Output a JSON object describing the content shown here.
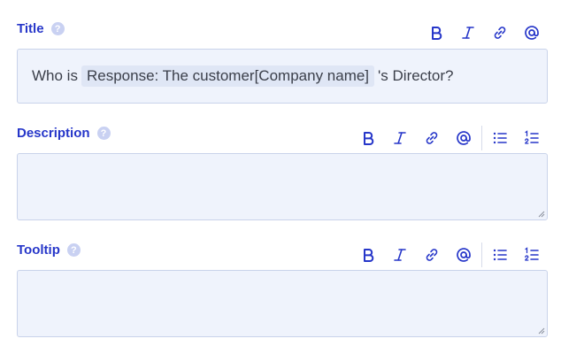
{
  "title_field": {
    "label": "Title",
    "help": "?",
    "text_before": "Who is",
    "pill": "Response: The customer[Company name]",
    "text_after": "'s Director?"
  },
  "description_field": {
    "label": "Description",
    "help": "?"
  },
  "tooltip_field": {
    "label": "Tooltip",
    "help": "?"
  },
  "toolbar_icons": [
    "bold-icon",
    "italic-icon",
    "link-icon",
    "mention-icon",
    "bulleted-list-icon",
    "numbered-list-icon"
  ],
  "colors": {
    "label": "#2636c9",
    "icon": "#2636c9",
    "field_bg": "#eff3fc",
    "field_border": "#c9d3ea",
    "pill_bg": "#dfe6f5"
  }
}
